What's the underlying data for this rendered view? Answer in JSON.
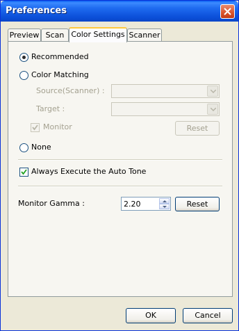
{
  "window": {
    "title": "Preferences"
  },
  "tabs": [
    {
      "label": "Preview"
    },
    {
      "label": "Scan"
    },
    {
      "label": "Color Settings"
    },
    {
      "label": "Scanner"
    }
  ],
  "color_settings": {
    "mode_options": {
      "recommended": "Recommended",
      "color_matching": "Color Matching",
      "none": "None"
    },
    "selected_mode": "Recommended",
    "source_label": "Source(Scanner) :",
    "source_value": "",
    "target_label": "Target :",
    "target_value": "",
    "monitor_label": "Monitor",
    "monitor_checked": true,
    "reset_disabled_label": "Reset",
    "auto_tone_label": "Always Execute the Auto Tone",
    "auto_tone_checked": true,
    "gamma_label": "Monitor Gamma :",
    "gamma_value": "2.20",
    "gamma_reset_label": "Reset"
  },
  "footer": {
    "ok_label": "OK",
    "cancel_label": "Cancel"
  },
  "icons": {
    "close": "close-icon",
    "dropdown": "chevron-down-icon",
    "spin_up": "chevron-up-icon",
    "spin_down": "chevron-down-icon",
    "check": "check-icon"
  },
  "colors": {
    "titlebar": "#0b4fd8",
    "window_bg": "#ece9d8",
    "close_button": "#d9532c",
    "tab_highlight": "#ffc83c",
    "radio_dot": "#2b2b2b"
  }
}
